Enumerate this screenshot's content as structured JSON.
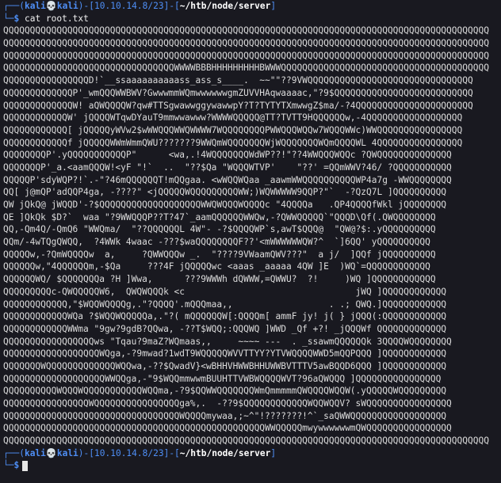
{
  "prompt": {
    "user": "kali",
    "host": "kali",
    "ip": "10.10.14.8/23",
    "path": "~/htb/node/server",
    "dollar": "$",
    "box_top": "┌──(",
    "box_bottom": "└─",
    "mid1": ")-[",
    "mid2": "]-[",
    "end": "]"
  },
  "command": "cat root.txt",
  "art_lines": [
    "QQQQQQQQQQQQQQQQQQQQQQQQQQQQQQQQQQQQQQQQQQQQQQQQQQQQQQQQQQQQQQQQQQQQQQQQQQQQQQQQQQQQQQQQQQQ",
    "QQQQQQQQQQQQQQQQQQQQQQQQQQQQQQQQQQQQQQQQQQQQQQQQQQQQQQQQQQQQQQQQQQQQQQQQQQQQQQQQQQQQQQQQQQQ",
    "QQQQQQQQQQQQQQQQQQQQQQQQQQQQQQQQQQQQQQQQQQQQQQQQQQQQQQQQQQQQQQQQQQQQQQQQQQQQQQQQQQQQQQQQQQQ",
    "QQQQQQQQQQQQQQQQQQQQQQQQQQQQQQQQWWWWBBBHHHHHHHHHBWWWQQQQQQQQQQQQQQQQQQQQQQQQQQQQQQQQQQQQQQQ",
    "QQQQQQQQQQQQQQQQD!`__ssaaaaaaaaaass_ass_s____.  ~~\"\"??9VWQQQQQQQQQQQQQQQQQQQQQQQQQQQQQQQ",
    "QQQQQQQQQQQQQP'_wmQQQWWBWV?GwwwmmWQmwwwwwwgmZUVVHAqwaaaac,\"?9$QQQQQQQQQQQQQQQQQQQQQQQQQQ",
    "QQQQQQQQQQQQQW! aQWQQQQW?qw#TTSgwawwggywawwpY?T?TYTYTXmwwgZ$ma/-?4QQQQQQQQQQQQQQQQQQQQQQ",
    "QQQQQQQQQQQQW' jQQQQWTqwDYauT9mmwwawww?WWWWQQQQQ@TT?TVTT9HQQQQQQw,-4QQQQQQQQQQQQQQQQQQ",
    "QQQQQQQQQQQQ[ jQQQQQyWVw2$wWWQQQWWQWWWW7WQQQQQQQQPWWQQQWQQw7WQQQWWc)WWQQQQQQQQQQQQQQQQ",
    "QQQQQQQQQQQQf jQQQQQWWmWmmQWU???????9WWQmWQQQQQQQWjWQQQQQQQWQmQQQQWL 4QQQQQQQQQQQQQQQQ",
    "QQQQQQQQP'.yQQQQQQQQQQQP\"      <wa,.!4WQQQQQQQWdWP??!\"??4WWQQQWQQc ?QWQQQQQQQQQQQQQQ",
    "QQQQQQQP'_a.<aamQQQW!<yF \"!`  ..  \"??$Qa \"WQQQWTVP'    \"??' =QQmWWV?46/ ?QQQQQQQQQQQ",
    "QQQQQP'sdyWQP?!`.-\"?46mQQQQQQT!mQQgaa. <wWQQWQaa _aawmWWQQQQQQQQQQWP4a7g -WWQQQQQQQQ",
    "QQ[ j@mQP'adQQP4ga, -????\" <jQQQQQWQQQQQQQQQWW;)WQWWWWW9QQP?\"`  -?QzQ7L ]QQQQQQQQQQ",
    "QW jQkQ@ jWQQD'-?$QQQQQQQQQQQQQQQQQQQWWQWQQQWQQQQc \"4QQQQa   .QP4QQQQfWkl jQQQQQQQQ",
    "QE ]QkQk $D?`  waa \"?9WWQQQP??T?47`_aamQQQQQQWWQw,-?QWWQQQQQ`\"QQQD\\Qf(.QWQQQQQQQQ",
    "QQ,-Qm4Q/-QmQ6 \"WWQma/  \"??QQQQQQL 4W\"- -?$QQQQWP`s,awT$QQQ@  \"QW@?$:.yQQQQQQQQQQ",
    "QQm/-4wTQgQWQQ,  ?4WWk 4waac -???$waQQQQQQQQF??'<mWWWWWWQW?^  `]6QQ' yQQQQQQQQQQ",
    "QQQQQw,-?QmWQQQQw  a,     ?QWWQQQw _.  \"????9VWaamQWV???\"  a j/  ]QQf jQQQQQQQQQQ",
    "QQQQQQw,\"4QQQQQQm,-$Qa     ???4F jQQQQQwc <aaas _aaaaa 4QW ]E  )WQ`=QQQQQQQQQQQQ",
    "QQQQQQWQ/ $QQQQQQQa ?H ]Wwa,      ???9WWWh dQWWW,=QWWU?  ?!     )WQ ]QQQQQQQQQQQQ",
    "QQQQQQQQQc-QWQQQQQW6,  QWQWQQQk <c                                jWQ ]QQQQQQQQQQQQ",
    "QQQQQQQQQQQQ,\"$WQQWQQQQg,.\"?QQQQ'.mQQQmaa,,                  . .; QWQ.]QQQQQQQQQQQQ",
    "QQQQQQQQQQQQWQa ?$WQQWQQQQQa,.\"?( mQQQQQQW[:QQQQm[ ammF jy! j( } jQQQ(:QQQQQQQQQQQQ",
    "QQQQQQQQQQQQWWma \"9gw?9gdB?QQwa, -??T$WQQ;:QQQWQ ]WWD _Qf +?! _jQQQWf QQQQQQQQQQQQQ",
    "QQQQQQQQQQQQQQQQQws \"Tqau?9maZ?WQmaas,,     ~~~~ ---  . _ssawmQQQQQQk 3QQQQWQQQQQQQQ",
    "QQQQQQQQQQQQQQQQQQWQga,-?9mwad?1wdT9WQQQQQWVVTTYY?YTVWQQQQWWD5mQQPQQQ ]QQQQQQQQQQQQ",
    "QQQQQQQWQQQQQQQQQQQQQWQQwa,-??$QwadV}<wBHHVHWWBHHUWWBVTTTV5awBQQD6QQQ ]QQQQQQQQQQQQ",
    "QQQQQQQQQQQQQQQQQQQWWQQga,-\"9$WQQmmwwmBUUHTTVWBWQQQQWVT?96aQWQQQ ]QQQQQQQQQQQQQQQQ",
    "QQQQQQQQQQWQQQWQQQQQQQQQQQWQQma,-?9$QQWWQQQQQQQWmQmmmmmQWQQQQWQQW(.yQQQQQWQQQQQQQQQ",
    "QQQQQQQQQQQQQQQQWQQQQQQQQQQQQQQQQga%,.  -??9$QQQQQQQQQQQQWQQWQQV? sWQQQQQQQQQQQQQQQQ",
    "QQQQQQQQQQQQQQQQQQQQQQQQQQQQQQQQQWQQQQmywaa,;~^\"!???????!^`_saQWWQQQQQQQQQQQQQQQQQQ",
    "QQQQQQQQQQQQQQQQQQQQQQQQQQQQQQQQQQQQQQQQQQQQQQQQQWWQQQQQmwywwwwwwmQWQQQQQQQQQQQQQQQQ",
    "QQQQQQQQQQQQQQQQQQQQQQQQQQQQQQQQQQQQQQQQQQQQQQQQQQQQQQQQQQQQQQQQQQQQQQQQQQQQQQQQQQQQQQQQQQQ"
  ]
}
